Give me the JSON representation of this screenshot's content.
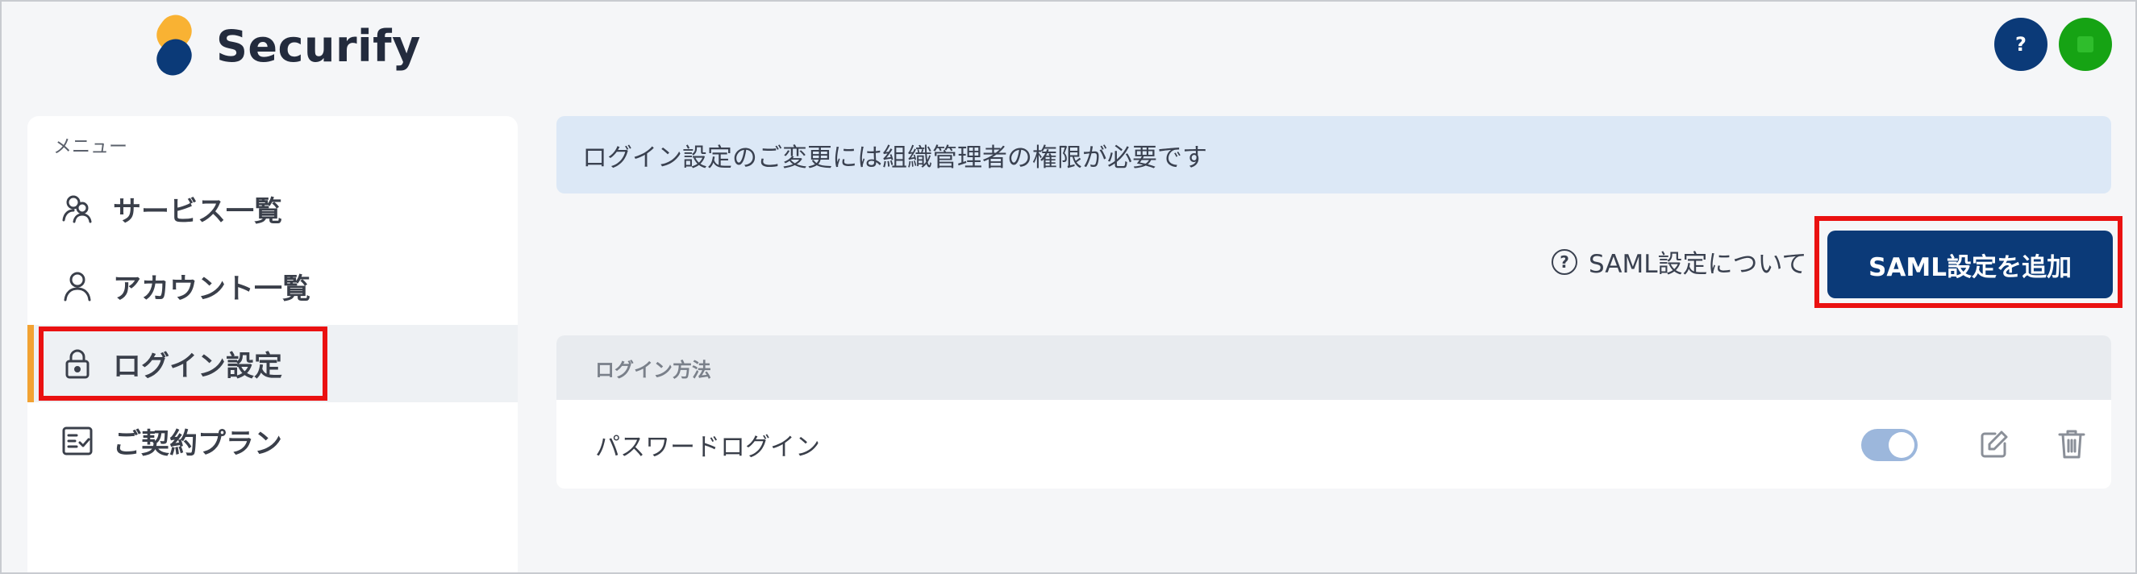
{
  "header": {
    "brand": "Securify",
    "help_label": "?",
    "brand_colors": [
      "#f9b233",
      "#0b3a78"
    ]
  },
  "sidebar": {
    "section_label": "メニュー",
    "items": [
      {
        "label": "サービス一覧",
        "icon": "users-icon",
        "active": false
      },
      {
        "label": "アカウント一覧",
        "icon": "user-icon",
        "active": false
      },
      {
        "label": "ログイン設定",
        "icon": "lock-icon",
        "active": true
      },
      {
        "label": "ご契約プラン",
        "icon": "checklist-icon",
        "active": false
      }
    ]
  },
  "main": {
    "notice": "ログイン設定のご変更には組織管理者の権限が必要です",
    "saml_help_label": "SAML設定について",
    "saml_add_label": "SAML設定を追加",
    "table": {
      "header": "ログイン方法",
      "rows": [
        {
          "label": "パスワードログイン",
          "enabled": true
        }
      ]
    }
  },
  "colors": {
    "accent": "#0b3a78",
    "active_bar": "#f2a232",
    "highlight": "#ea1111",
    "notice_bg": "#dce8f6",
    "avatar": "#16a314"
  }
}
